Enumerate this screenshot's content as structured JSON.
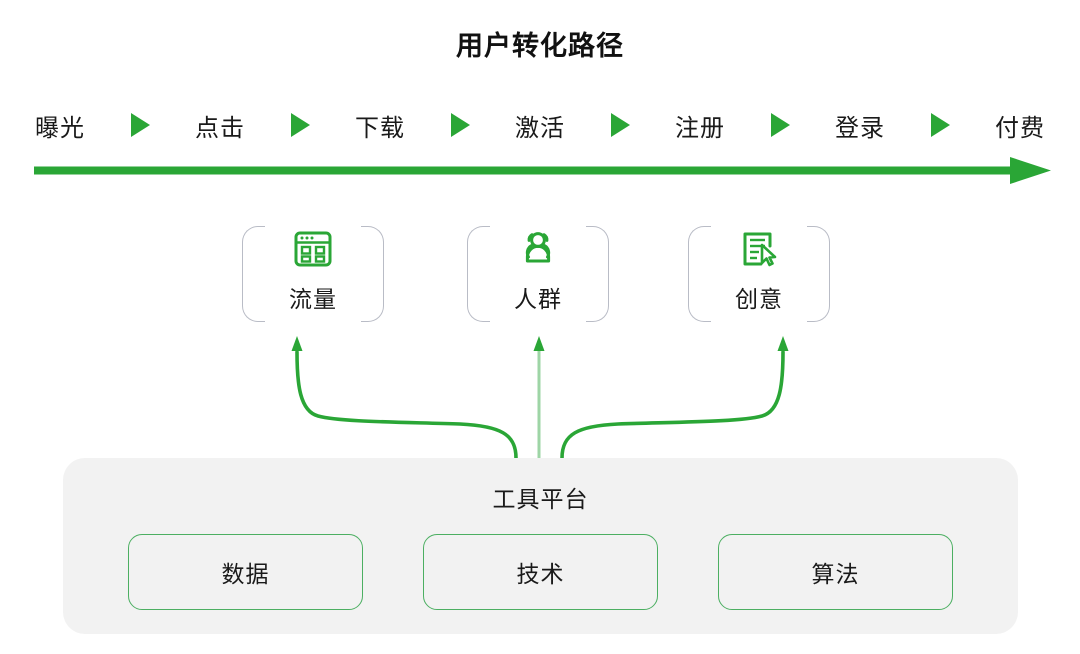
{
  "title": "用户转化路径",
  "funnel": {
    "steps": [
      "曝光",
      "点击",
      "下载",
      "激活",
      "注册",
      "登录",
      "付费"
    ],
    "separator_icon": "triangle-right-icon",
    "main_arrow_icon": "long-right-arrow-icon"
  },
  "pillars": [
    {
      "label": "流量",
      "icon": "browser-grid-icon"
    },
    {
      "label": "人群",
      "icon": "people-group-icon"
    },
    {
      "label": "创意",
      "icon": "document-cursor-icon"
    }
  ],
  "connectors": [
    {
      "icon": "curved-up-arrow-left-icon"
    },
    {
      "icon": "straight-up-arrow-icon"
    },
    {
      "icon": "curved-up-arrow-right-icon"
    }
  ],
  "platform": {
    "title": "工具平台",
    "items": [
      "数据",
      "技术",
      "算法"
    ]
  },
  "colors": {
    "green": "#2AA636",
    "green_light": "#9ED5A6",
    "green_outline": "#4CAF62",
    "bracket_gray": "#b9bcc6",
    "panel_gray": "#f2f2f2",
    "text": "#1a1a1a"
  }
}
